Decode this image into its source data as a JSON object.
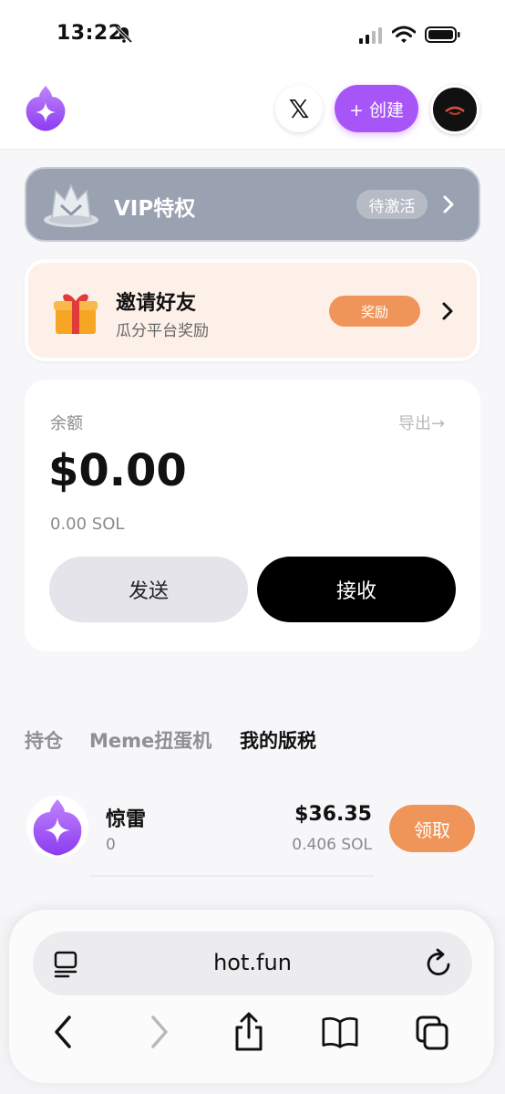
{
  "status_bar": {
    "time": "13:22"
  },
  "header": {
    "create_label": "+ 创建",
    "x_label": "𝕏"
  },
  "vip": {
    "title": "VIP特权",
    "status": "待激活"
  },
  "invite": {
    "title": "邀请好友",
    "subtitle": "瓜分平台奖励",
    "badge": "奖励"
  },
  "balance": {
    "label": "余额",
    "export": "导出→",
    "usd": "$0.00",
    "sol": "0.00 SOL",
    "send_label": "发送",
    "receive_label": "接收"
  },
  "tabs": [
    {
      "label": "持仓"
    },
    {
      "label": "Meme扭蛋机"
    },
    {
      "label": "我的版税"
    }
  ],
  "holdings": [
    {
      "name": "惊雷",
      "amount": "0",
      "usd": "$36.35",
      "sol": "0.406 SOL",
      "action": "领取"
    }
  ],
  "browser": {
    "url": "hot.fun"
  },
  "colors": {
    "accent": "#a855f7",
    "orange": "#f0955a",
    "vip_bg": "#9aa1b1",
    "invite_bg": "#fdf0e9"
  }
}
